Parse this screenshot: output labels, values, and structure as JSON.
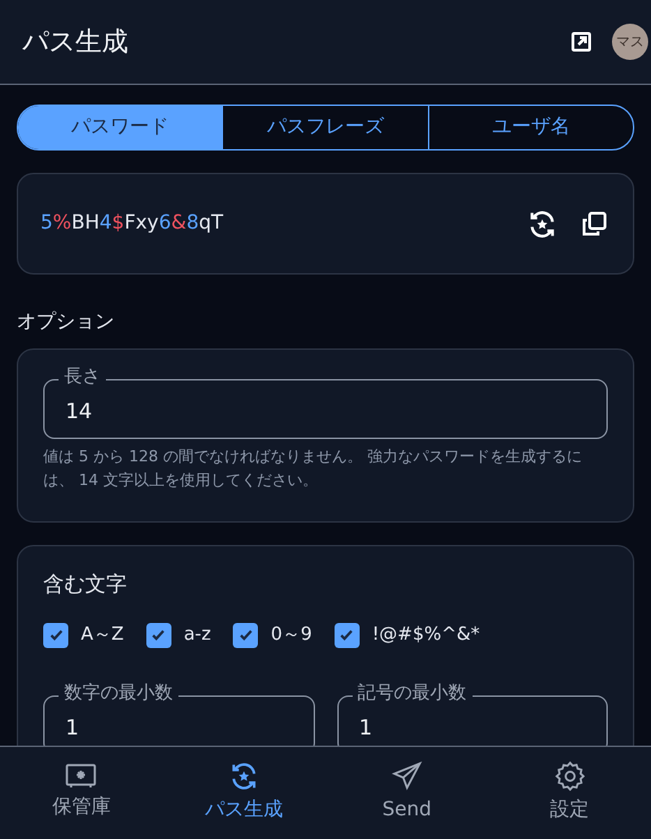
{
  "header": {
    "title": "パス生成",
    "avatar": "マス"
  },
  "tabs": [
    {
      "label": "パスワード",
      "selected": true
    },
    {
      "label": "パスフレーズ",
      "selected": false
    },
    {
      "label": "ユーザ名",
      "selected": false
    }
  ],
  "password": [
    {
      "kind": "digit",
      "text": "5"
    },
    {
      "kind": "symbol",
      "text": "%"
    },
    {
      "kind": "letter",
      "text": "BH"
    },
    {
      "kind": "digit",
      "text": "4"
    },
    {
      "kind": "symbol",
      "text": "$"
    },
    {
      "kind": "letter",
      "text": "Fxy"
    },
    {
      "kind": "digit",
      "text": "6"
    },
    {
      "kind": "symbol",
      "text": "&"
    },
    {
      "kind": "digit",
      "text": "8"
    },
    {
      "kind": "letter",
      "text": "qT"
    }
  ],
  "options": {
    "heading": "オプション",
    "length": {
      "label": "長さ",
      "value": "14"
    },
    "hint": "値は 5 から 128 の間でなければなりません。 強力なパスワードを生成するには、 14 文字以上を使用してください。"
  },
  "include": {
    "heading": "含む文字",
    "checkboxes": [
      {
        "label": "A～Z",
        "checked": true
      },
      {
        "label": "a-z",
        "checked": true
      },
      {
        "label": "0～9",
        "checked": true
      },
      {
        "label": "!@#$%^&*",
        "checked": true
      }
    ],
    "fields": [
      {
        "label": "数字の最小数",
        "value": "1"
      },
      {
        "label": "記号の最小数",
        "value": "1"
      }
    ]
  },
  "nav": [
    {
      "kind": "vault",
      "label": "保管庫",
      "selected": false
    },
    {
      "kind": "generator",
      "label": "パス生成",
      "selected": true
    },
    {
      "kind": "send",
      "label": "Send",
      "selected": false
    },
    {
      "kind": "settings",
      "label": "設定",
      "selected": false
    }
  ]
}
